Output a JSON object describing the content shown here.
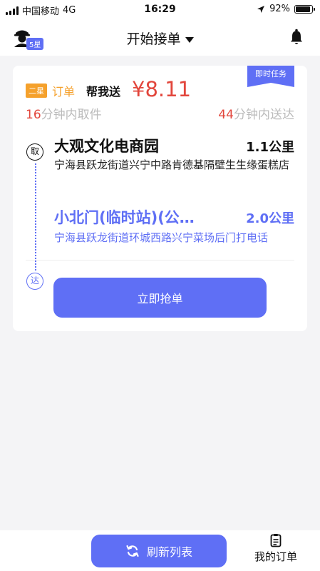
{
  "status_bar": {
    "carrier": "中国移动",
    "network": "4G",
    "time": "16:29",
    "battery": "92%",
    "battery_level": 0.92
  },
  "header": {
    "title": "开始接单",
    "level_badge": "5星"
  },
  "order": {
    "ribbon": "即时任务",
    "grade": "二星",
    "order_label": "订单",
    "service": "帮我送",
    "price": "¥8.11",
    "pickup_time": {
      "num": "16",
      "text": "分钟内取件"
    },
    "delivery_time": {
      "num": "44",
      "text": "分钟内送达"
    },
    "pickup": {
      "icon_char": "取",
      "name": "大观文化电商园",
      "distance": "1.1公里",
      "address": "宁海县跃龙街道兴宁中路肯德基隔壁生生缘蛋糕店"
    },
    "dropoff": {
      "icon_char": "达",
      "name": "小北门(临时站)(公…",
      "distance": "2.0公里",
      "address": "宁海县跃龙街道环城西路兴宁菜场后门打电话"
    },
    "grab_button": "立即抢单"
  },
  "bottom_bar": {
    "refresh_button": "刷新列表",
    "my_orders": "我的订单"
  },
  "colors": {
    "accent": "#5f6ff5",
    "price": "#e2463c",
    "tag": "#f5a12c"
  }
}
